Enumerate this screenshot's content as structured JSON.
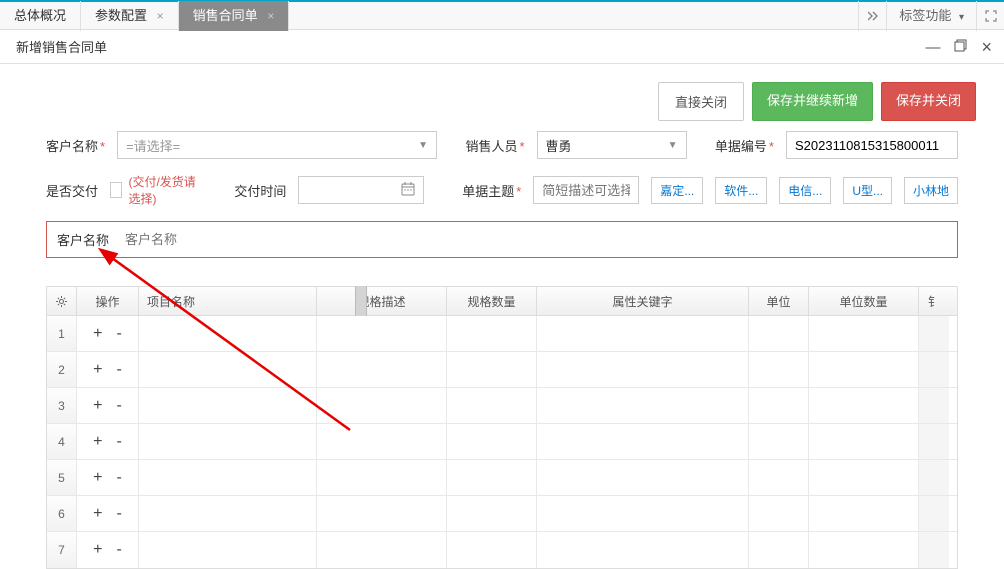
{
  "tabs": [
    {
      "label": "总体概况",
      "active": false,
      "closable": false
    },
    {
      "label": "参数配置",
      "active": false,
      "closable": true
    },
    {
      "label": "销售合同单",
      "active": true,
      "closable": true
    }
  ],
  "topRight": {
    "labelFn": "标签功能",
    "caretDown": "▾"
  },
  "subHeader": {
    "title": "新增销售合同单"
  },
  "buttons": {
    "directClose": "直接关闭",
    "saveContinue": "保存并继续新增",
    "saveClose": "保存并关闭"
  },
  "form": {
    "customerName": {
      "label": "客户名称",
      "placeholder": "=请选择="
    },
    "salesperson": {
      "label": "销售人员",
      "value": "曹勇"
    },
    "billNo": {
      "label": "单据编号",
      "value": "S2023110815315800011"
    },
    "delivered": {
      "label": "是否交付",
      "tip": "(交付/发货请选择)"
    },
    "deliverTime": {
      "label": "交付时间"
    },
    "subject": {
      "label": "单据主题",
      "placeholder": "简短描述可选择标"
    },
    "tags": [
      "嘉定...",
      "软件...",
      "电信...",
      "U型...",
      "小林地"
    ],
    "custNameField": {
      "label": "客户名称",
      "placeholder": "客户名称"
    }
  },
  "table": {
    "headers": {
      "op": "操作",
      "itemName": "项目名称",
      "spec": "规格描述",
      "qty": "规格数量",
      "attr": "属性关键字",
      "unit": "单位",
      "unitQty": "单位数量",
      "last": "钅"
    },
    "rows": [
      {
        "num": "1"
      },
      {
        "num": "2"
      },
      {
        "num": "3"
      },
      {
        "num": "4"
      },
      {
        "num": "5"
      },
      {
        "num": "6"
      },
      {
        "num": "7"
      }
    ],
    "plus": "+",
    "minus": "-"
  }
}
